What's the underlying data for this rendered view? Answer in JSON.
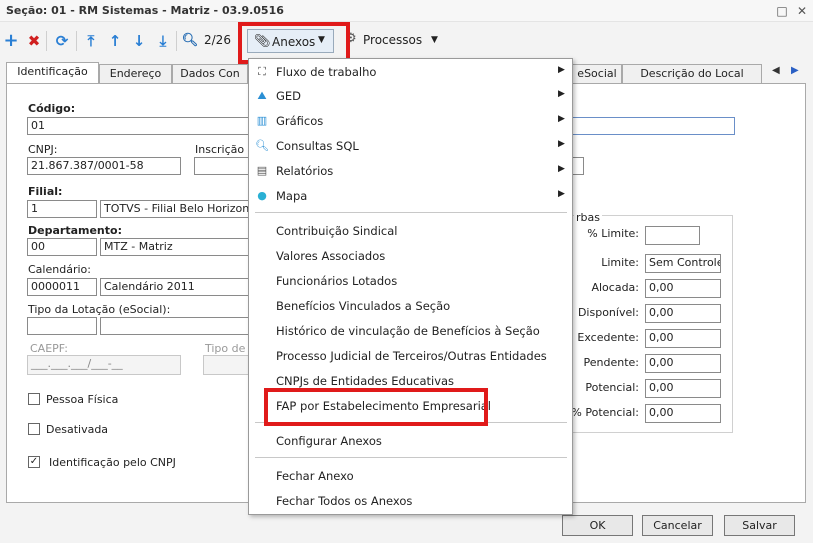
{
  "window": {
    "title": "Seção: 01 - RM Sistemas - Matriz - 03.9.0516"
  },
  "toolbar": {
    "record_position": "2/26",
    "anexos_label": "Anexos",
    "processos_label": "Processos"
  },
  "tabs": [
    "Identificação",
    "Endereço",
    "Dados Con",
    "eSocial",
    "Descrição do Local"
  ],
  "form": {
    "codigo_label": "Código:",
    "codigo_value": "01",
    "cnpj_label": "CNPJ:",
    "cnpj_value": "21.867.387/0001-58",
    "inscricao_label": "Inscrição E",
    "filial_label": "Filial:",
    "filial_code": "1",
    "filial_name": "TOTVS - Filial Belo Horizonte",
    "departamento_label": "Departamento:",
    "departamento_code": "00",
    "departamento_name": "MTZ - Matriz",
    "calendario_label": "Calendário:",
    "calendario_code": "0000011",
    "calendario_name": "Calendário 2011",
    "tipo_lotacao_label": "Tipo da Lotação (eSocial):",
    "caepf_label": "CAEPF:",
    "caepf_value": "___.___.___/___-__",
    "tipo_c_label": "Tipo de C",
    "pessoa_fisica_label": "Pessoa Física",
    "desativada_label": "Desativada",
    "identificacao_cnpj_label": "Identificação pelo CNPJ"
  },
  "verbas": {
    "title": "rbas",
    "fields": [
      {
        "label": "% Limite:",
        "value": ""
      },
      {
        "label": "Limite:",
        "value": "Sem Controle"
      },
      {
        "label": "Alocada:",
        "value": "0,00"
      },
      {
        "label": "Disponível:",
        "value": "0,00"
      },
      {
        "label": "Excedente:",
        "value": "0,00"
      },
      {
        "label": "Pendente:",
        "value": "0,00"
      },
      {
        "label": "Potencial:",
        "value": "0,00"
      },
      {
        "label": "% Potencial:",
        "value": "0,00"
      }
    ]
  },
  "menu": {
    "items": [
      {
        "label": "Fluxo de trabalho",
        "icon": "workflow-icon",
        "submenu": true
      },
      {
        "label": "GED",
        "icon": "ged-icon",
        "submenu": true
      },
      {
        "label": "Gráficos",
        "icon": "chart-icon",
        "submenu": true
      },
      {
        "label": "Consultas SQL",
        "icon": "search-icon",
        "submenu": true
      },
      {
        "label": "Relatórios",
        "icon": "report-icon",
        "submenu": true
      },
      {
        "label": "Mapa",
        "icon": "map-pin-icon",
        "submenu": true
      },
      {
        "label": "Contribuição Sindical"
      },
      {
        "label": "Valores Associados"
      },
      {
        "label": "Funcionários Lotados"
      },
      {
        "label": "Benefícios Vinculados a Seção"
      },
      {
        "label": "Histórico de vinculação de Benefícios à Seção"
      },
      {
        "label": "Processo Judicial de Terceiros/Outras Entidades"
      },
      {
        "label": "CNPJs de Entidades Educativas"
      },
      {
        "label": "FAP por Estabelecimento Empresarial"
      },
      {
        "label": "Configurar Anexos"
      },
      {
        "label": "Fechar Anexo"
      },
      {
        "label": "Fechar Todos os Anexos"
      }
    ]
  },
  "buttons": {
    "ok": "OK",
    "cancelar": "Cancelar",
    "salvar": "Salvar"
  },
  "colors": {
    "highlight": "#e01a1a",
    "add_icon": "#2a7fd4",
    "delete_icon": "#d02020"
  }
}
